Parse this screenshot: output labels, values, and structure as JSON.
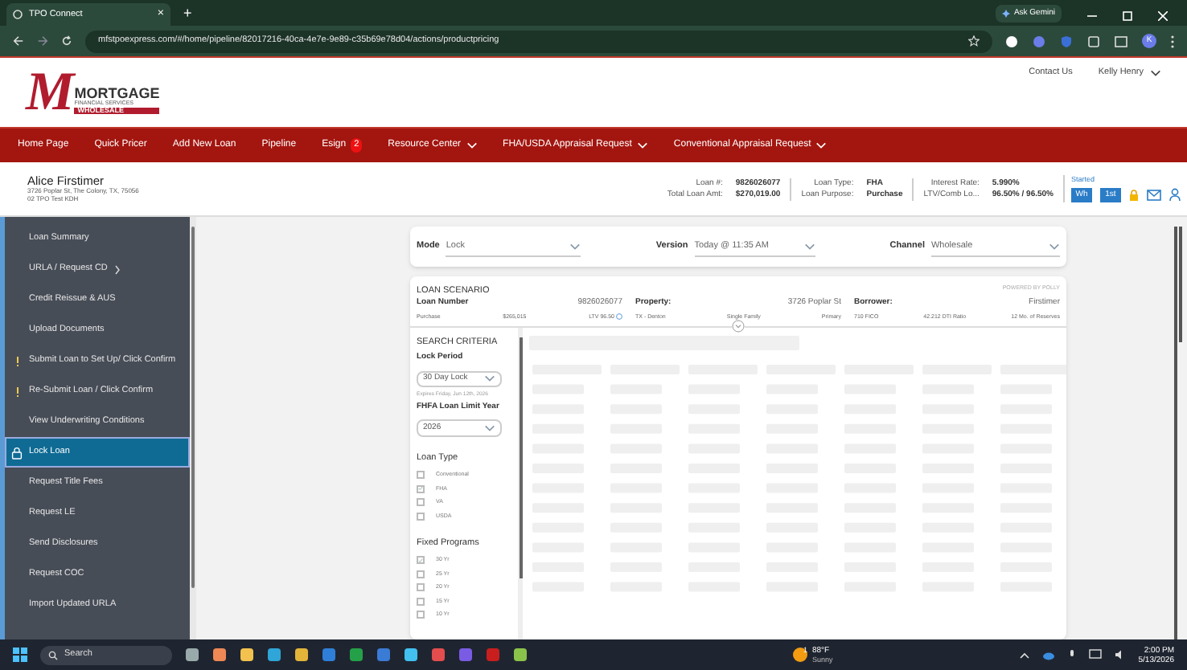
{
  "browser": {
    "tab_title": "TPO Connect",
    "tab_close": "×",
    "new_tab": "+",
    "gemini": "Ask Gemini",
    "url": "mfstpoexpress.com/#/home/pipeline/82017216-40ca-4e7e-9e89-c35b69e78d04/actions/productpricing",
    "profile": "K"
  },
  "header": {
    "logo": {
      "mark": "M",
      "line1": "MORTGAGE",
      "line2": "FINANCIAL SERVICES",
      "line3": "WHOLESALE"
    },
    "links": [
      {
        "label": "Contact Us",
        "dropdown": false
      },
      {
        "label": "Kelly Henry",
        "dropdown": true
      }
    ]
  },
  "nav": [
    {
      "label": "Home Page",
      "dropdown": false
    },
    {
      "label": "Quick Pricer",
      "dropdown": false
    },
    {
      "label": "Add New Loan",
      "dropdown": false
    },
    {
      "label": "Pipeline",
      "dropdown": false
    },
    {
      "label": "Esign",
      "badge": "2",
      "dropdown": false
    },
    {
      "label": "Resource Center",
      "dropdown": true
    },
    {
      "label": "FHA/USDA Appraisal Request",
      "dropdown": true
    },
    {
      "label": "Conventional Appraisal Request",
      "dropdown": true
    }
  ],
  "loan": {
    "borrower": "Alice Firstimer",
    "address": "3726 Poplar St, The Colony, TX, 75056",
    "note": "02 TPO Test KDH",
    "columns": [
      [
        {
          "label": "Loan #:",
          "value": "9826026077"
        },
        {
          "label": "Total Loan Amt:",
          "value": "$270,019.00"
        }
      ],
      [
        {
          "label": "Loan Type:",
          "value": "FHA"
        },
        {
          "label": "Loan Purpose:",
          "value": "Purchase"
        }
      ],
      [
        {
          "label": "Interest Rate:",
          "value": "5.990%"
        },
        {
          "label": "LTV/Comb Lo...",
          "value": "96.50% / 96.50%"
        }
      ]
    ],
    "status": "Started",
    "buttons": [
      "Wh",
      "1st"
    ]
  },
  "sidebar": {
    "items": [
      {
        "label": "Loan Summary",
        "selected": false,
        "alert": false
      },
      {
        "label": "URLA / Request CD",
        "selected": false,
        "alert": false,
        "submenu": true
      },
      {
        "label": "Credit Reissue & AUS",
        "selected": false,
        "alert": false
      },
      {
        "label": "Upload Documents",
        "selected": false,
        "alert": false
      },
      {
        "label": "Submit Loan to Set Up/ Click Confirm",
        "selected": false,
        "alert": true
      },
      {
        "label": "Re-Submit Loan / Click Confirm",
        "selected": false,
        "alert": true
      },
      {
        "label": "View Underwriting Conditions",
        "selected": false,
        "alert": false
      },
      {
        "label": "Lock Loan",
        "selected": true,
        "alert": false
      },
      {
        "label": "Request Title Fees",
        "selected": false,
        "alert": false
      },
      {
        "label": "Request LE",
        "selected": false,
        "alert": false
      },
      {
        "label": "Send Disclosures",
        "selected": false,
        "alert": false
      },
      {
        "label": "Request COC",
        "selected": false,
        "alert": false
      },
      {
        "label": "Import Updated URLA",
        "selected": false,
        "alert": false
      }
    ]
  },
  "pricing": {
    "selectors": [
      {
        "label": "Mode",
        "value": "Lock"
      },
      {
        "label": "Version",
        "value": "Today @ 11:35 AM"
      },
      {
        "label": "Channel",
        "value": "Wholesale"
      }
    ],
    "scenario": {
      "title": "LOAN SCENARIO",
      "powered_by": "POWERED BY POLLY",
      "groups": [
        {
          "label": "Loan Number",
          "value": "9826026077",
          "details": [
            {
              "text": "Purchase",
              "kind": "plain"
            },
            {
              "text": "$265,015",
              "kind": "plain"
            },
            {
              "text": "LTV 96.50",
              "kind": "info"
            }
          ]
        },
        {
          "label": "Property:",
          "value": "3726 Poplar St",
          "details": [
            {
              "text": "TX - Denton",
              "kind": "plain"
            },
            {
              "text": "Single Family",
              "kind": "plain"
            },
            {
              "text": "Primary",
              "kind": "plain"
            }
          ]
        },
        {
          "label": "Borrower:",
          "value": "Firstimer",
          "details": [
            {
              "text": "710 FICO",
              "kind": "plain"
            },
            {
              "text": "42.212 DTI Ratio",
              "kind": "plain"
            },
            {
              "text": "12 Mo. of Reserves",
              "kind": "plain"
            }
          ]
        }
      ]
    },
    "criteria": {
      "title": "SEARCH CRITERIA",
      "lock_period": {
        "label": "Lock Period",
        "value": "30 Day Lock",
        "note": "Expires Friday, Jun 12th, 2026"
      },
      "loan_limit": {
        "label": "FHFA Loan Limit Year",
        "value": "2026"
      },
      "groups": [
        {
          "title": "Loan Type",
          "options": [
            {
              "label": "Conventional",
              "checked": false
            },
            {
              "label": "FHA",
              "checked": true
            },
            {
              "label": "VA",
              "checked": false
            },
            {
              "label": "USDA",
              "checked": false
            }
          ]
        },
        {
          "title": "Fixed Programs",
          "options": [
            {
              "label": "30 Yr",
              "checked": true
            },
            {
              "label": "25 Yr",
              "checked": false
            },
            {
              "label": "20 Yr",
              "checked": false
            },
            {
              "label": "15 Yr",
              "checked": false
            },
            {
              "label": "10 Yr",
              "checked": false
            }
          ]
        }
      ]
    }
  },
  "taskbar": {
    "search": "Search",
    "temperature": "88°F",
    "weather": "Sunny",
    "weather_badge": "1",
    "time": "2:00 PM",
    "date": "5/13/2026"
  }
}
